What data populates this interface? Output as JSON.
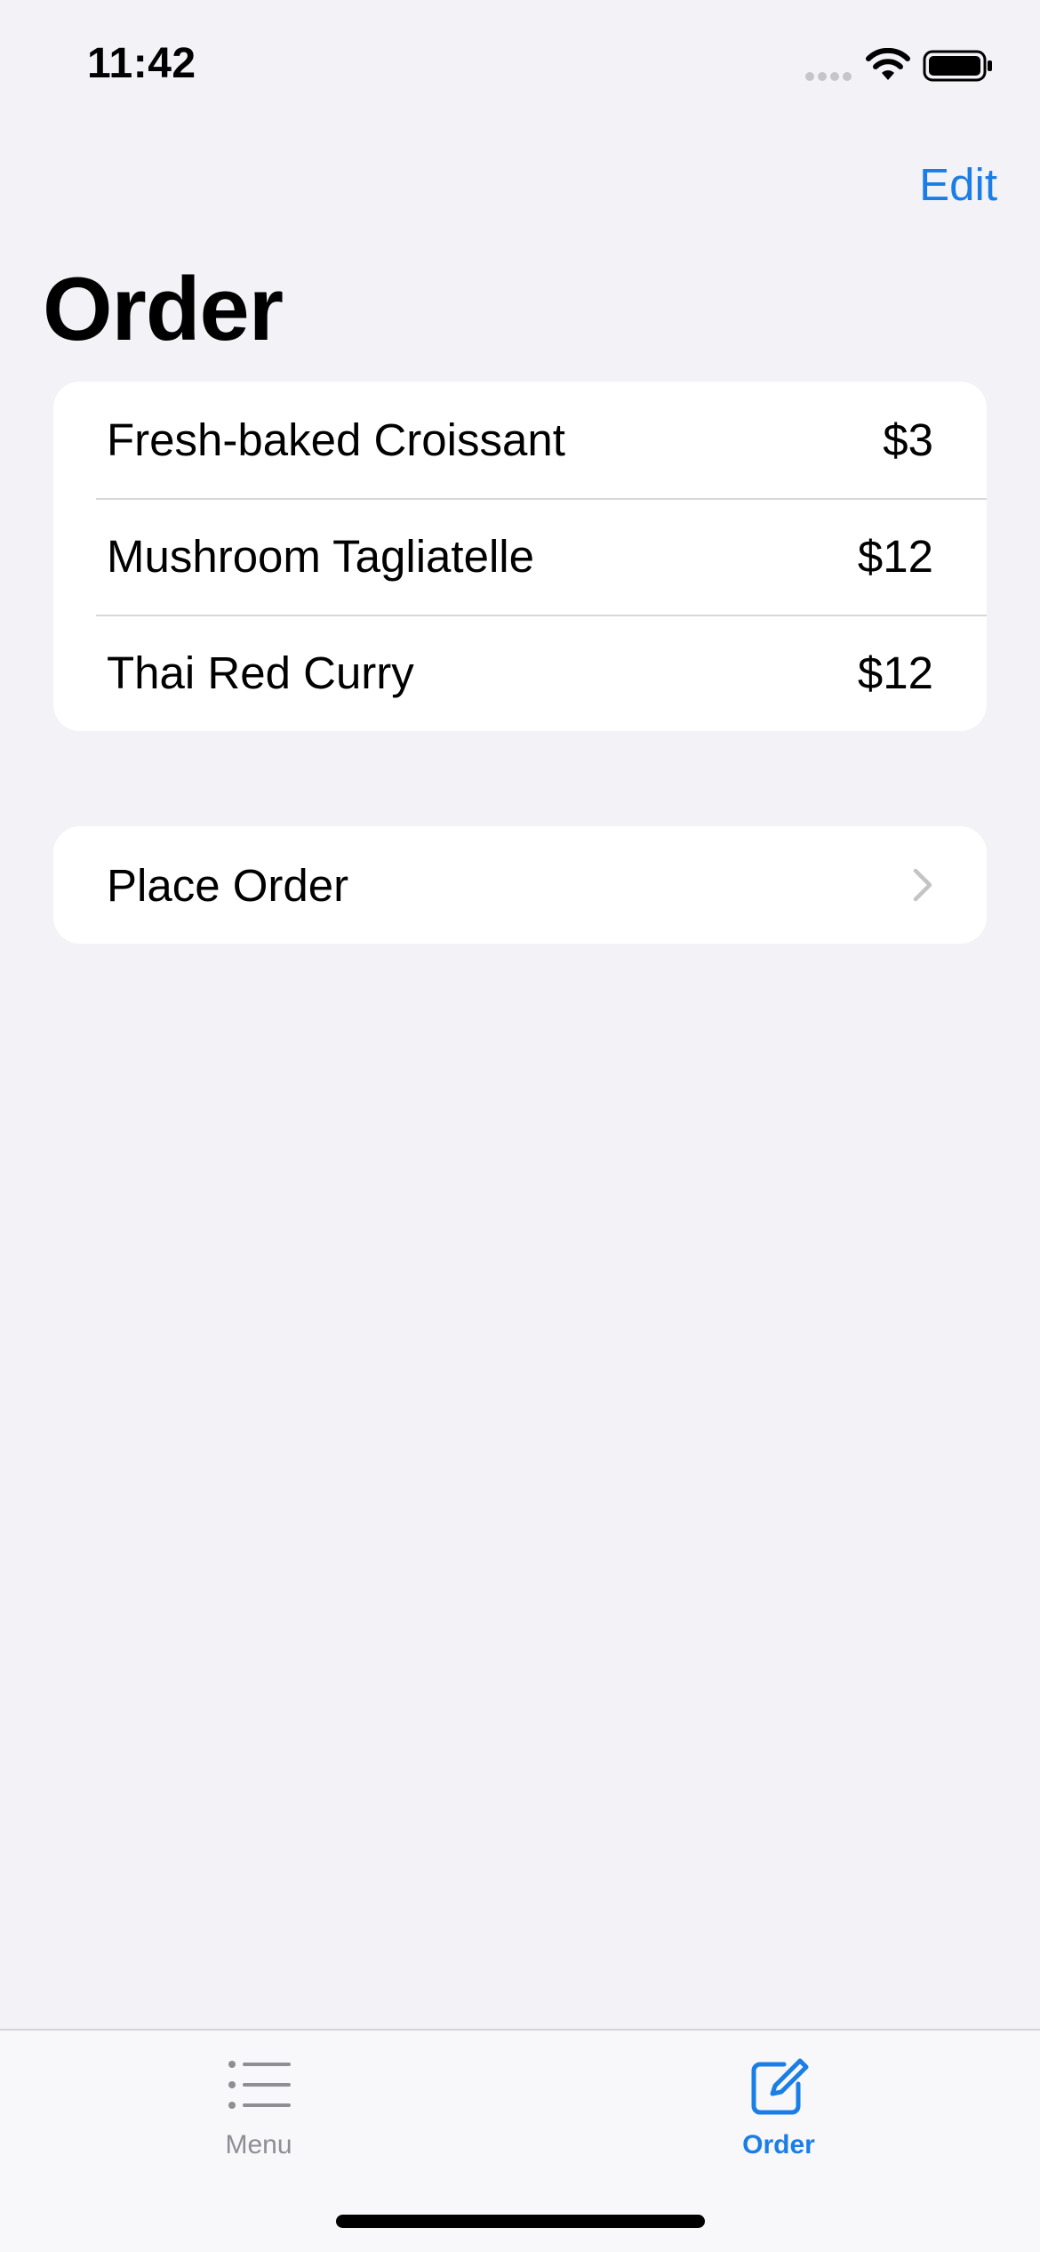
{
  "status_bar": {
    "time": "11:42"
  },
  "nav": {
    "edit_label": "Edit",
    "title": "Order"
  },
  "order_items": [
    {
      "name": "Fresh-baked Croissant",
      "price": "$3"
    },
    {
      "name": "Mushroom Tagliatelle",
      "price": "$12"
    },
    {
      "name": "Thai Red Curry",
      "price": "$12"
    }
  ],
  "place_order": {
    "label": "Place Order",
    "icon": "chevron-right-icon"
  },
  "tab_bar": {
    "tabs": [
      {
        "label": "Menu",
        "icon": "list-icon",
        "selected": false
      },
      {
        "label": "Order",
        "icon": "square-and-pencil-icon",
        "selected": true
      }
    ]
  },
  "colors": {
    "accent": "#1a7ee6",
    "background": "#f2f2f7",
    "inactive": "#8e8e93"
  }
}
